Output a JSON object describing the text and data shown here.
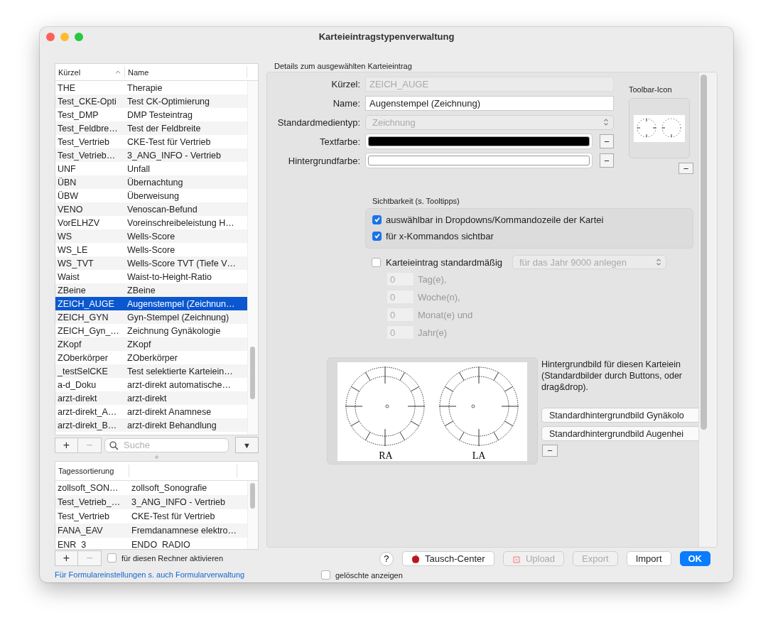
{
  "window": {
    "title": "Karteieintragstypenverwaltung"
  },
  "entry_table": {
    "columns": [
      {
        "label": "Kürzel",
        "sorted": true
      },
      {
        "label": "Name",
        "sorted": false
      }
    ],
    "rows": [
      {
        "kuerzel": "THE",
        "name": "Therapie",
        "selected": false
      },
      {
        "kuerzel": "Test_CKE-Opti",
        "name": "Test CK-Optimierung",
        "selected": false
      },
      {
        "kuerzel": "Test_DMP",
        "name": "DMP Testeintrag",
        "selected": false
      },
      {
        "kuerzel": "Test_Feldbre…",
        "name": "Test der Feldbreite",
        "selected": false
      },
      {
        "kuerzel": "Test_Vertrieb",
        "name": "CKE-Test für Vertrieb",
        "selected": false
      },
      {
        "kuerzel": "Test_Vetrieb…",
        "name": "3_ANG_INFO - Vertrieb",
        "selected": false
      },
      {
        "kuerzel": "UNF",
        "name": "Unfall",
        "selected": false
      },
      {
        "kuerzel": "ÜBN",
        "name": "Übernachtung",
        "selected": false
      },
      {
        "kuerzel": "ÜBW",
        "name": "Überweisung",
        "selected": false
      },
      {
        "kuerzel": "VENO",
        "name": "Venoscan-Befund",
        "selected": false
      },
      {
        "kuerzel": "VorELHZV",
        "name": "Voreinschreibeleistung H…",
        "selected": false
      },
      {
        "kuerzel": "WS",
        "name": "Wells-Score",
        "selected": false
      },
      {
        "kuerzel": "WS_LE",
        "name": "Wells-Score",
        "selected": false
      },
      {
        "kuerzel": "WS_TVT",
        "name": "Wells-Score TVT (Tiefe V…",
        "selected": false
      },
      {
        "kuerzel": "Waist",
        "name": "Waist-to-Height-Ratio",
        "selected": false
      },
      {
        "kuerzel": "ZBeine",
        "name": "ZBeine",
        "selected": false
      },
      {
        "kuerzel": "ZEICH_AUGE",
        "name": "Augenstempel (Zeichnun…",
        "selected": true
      },
      {
        "kuerzel": "ZEICH_GYN",
        "name": "Gyn-Stempel (Zeichnung)",
        "selected": false
      },
      {
        "kuerzel": "ZEICH_Gyn_…",
        "name": "Zeichnung Gynäkologie",
        "selected": false
      },
      {
        "kuerzel": "ZKopf",
        "name": "ZKopf",
        "selected": false
      },
      {
        "kuerzel": "ZOberkörper",
        "name": "ZOberkörper",
        "selected": false
      },
      {
        "kuerzel": "_testSelCKE",
        "name": "Test selektierte Karteiein…",
        "selected": false
      },
      {
        "kuerzel": "a-d_Doku",
        "name": "arzt-direkt automatische…",
        "selected": false
      },
      {
        "kuerzel": "arzt-direkt",
        "name": "arzt-direkt",
        "selected": false
      },
      {
        "kuerzel": "arzt-direkt_A…",
        "name": "arzt-direkt Anamnese",
        "selected": false
      },
      {
        "kuerzel": "arzt-direkt_B…",
        "name": "arzt-direkt Behandlung",
        "selected": false
      }
    ]
  },
  "entry_toolbar": {
    "add": "+",
    "remove": "−",
    "search": {
      "placeholder": "Suche"
    },
    "menu": "▼"
  },
  "day_table": {
    "columns": [
      "Tagessortierung"
    ],
    "rows": [
      {
        "kuerzel": "zollsoft_SON…",
        "name": "zollsoft_Sonografie"
      },
      {
        "kuerzel": "Test_Vetrieb_…",
        "name": "3_ANG_INFO - Vertrieb"
      },
      {
        "kuerzel": "Test_Vertrieb",
        "name": "CKE-Test für Vertrieb"
      },
      {
        "kuerzel": "FANA_EAV",
        "name": "Fremdanamnese elektro…"
      },
      {
        "kuerzel": "ENR_3",
        "name": "ENDO_RADIO"
      }
    ]
  },
  "day_toolbar": {
    "add": "+",
    "remove": "−",
    "activate": {
      "label": "für diesen Rechner aktivieren",
      "checked": false
    }
  },
  "form_link": "Für Formulareinstellungen s. auch Formularverwaltung",
  "details": {
    "title": "Details zum ausgewählten Karteieintrag",
    "kuerzel": {
      "label": "Kürzel:",
      "value": "ZEICH_AUGE",
      "disabled": true
    },
    "name": {
      "label": "Name:",
      "value": "Augenstempel (Zeichnung)",
      "disabled": false
    },
    "media_type": {
      "label": "Standardmedientyp:",
      "value": "Zeichnung",
      "disabled": true
    },
    "text_color": {
      "label": "Textfarbe:",
      "color": "#000000",
      "clear": "−"
    },
    "background_color": {
      "label": "Hintergrundfarbe:",
      "color": "#ffffff",
      "clear": "−"
    },
    "toolbar_icon": {
      "label": "Toolbar-Icon",
      "clear": "−"
    },
    "visibility": {
      "title": "Sichtbarkeit (s. Tooltipps)",
      "options": [
        {
          "label": "auswählbar in Dropdowns/Kommandozeile der Kartei",
          "checked": true
        },
        {
          "label": "für x-Kommandos sichtbar",
          "checked": true
        }
      ]
    },
    "default_entry": {
      "label": "Karteieintrag standardmäßig",
      "checked": false,
      "mode": "für das Jahr 9000 anlegen",
      "intervals": [
        {
          "value": "0",
          "unit": "Tag(e),"
        },
        {
          "value": "0",
          "unit": "Woche(n),"
        },
        {
          "value": "0",
          "unit": "Monat(e) und"
        },
        {
          "value": "0",
          "unit": "Jahr(e)"
        }
      ]
    },
    "background_image": {
      "labels": [
        "RA",
        "LA"
      ],
      "description": [
        "Hintergrundbild für diesen Karteiein",
        "(Standardbilder durch Buttons, oder",
        "drag&drop)."
      ],
      "buttons": [
        "Standardhintergrundbild Gynäkolo",
        "Standardhintergrundbild Augenhei"
      ],
      "clear": "−"
    }
  },
  "footer": {
    "help": "?",
    "buttons": [
      {
        "label": "Tausch-Center",
        "kind": "exchange",
        "disabled": false
      },
      {
        "label": "Upload",
        "kind": "upload",
        "disabled": true
      },
      {
        "label": "Export",
        "kind": "plain",
        "disabled": true
      },
      {
        "label": "Import",
        "kind": "plain",
        "disabled": false
      },
      {
        "label": "OK",
        "kind": "default",
        "disabled": false
      }
    ],
    "show_deleted": {
      "label": "gelöschte anzeigen",
      "checked": false
    }
  }
}
